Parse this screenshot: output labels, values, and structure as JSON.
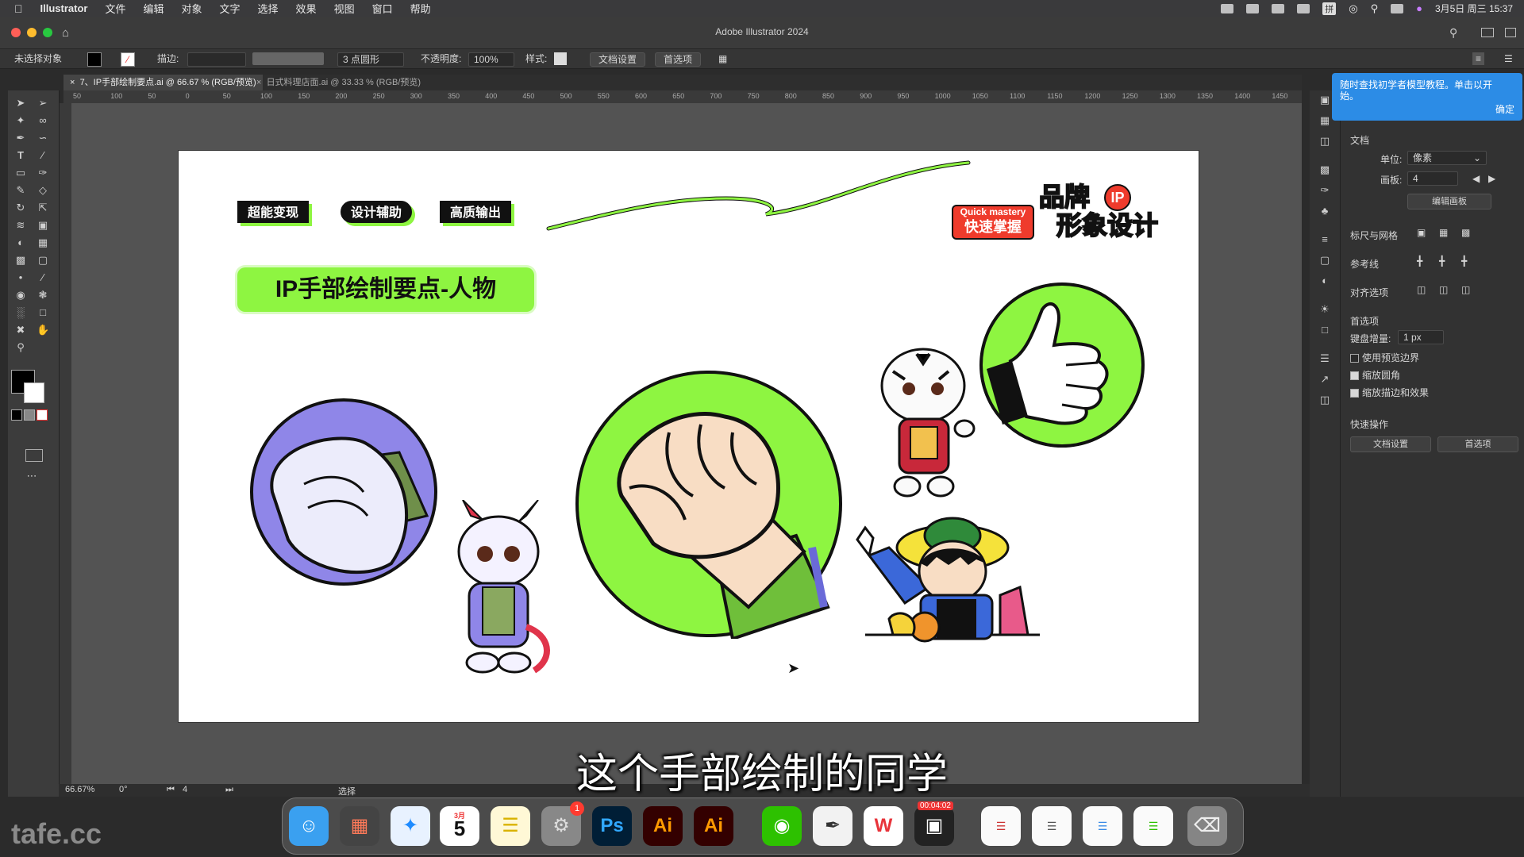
{
  "menubar": {
    "items": [
      "Illustrator",
      "文件",
      "编辑",
      "对象",
      "文字",
      "选择",
      "效果",
      "视图",
      "窗口",
      "帮助"
    ],
    "clock": "3月5日 周三 15:37",
    "ime": "拼"
  },
  "window": {
    "title": "Adobe Illustrator 2024"
  },
  "control": {
    "selection": "未选择对象",
    "stroke_label": "描边:",
    "brush": "3 点圆形",
    "opacity_label": "不透明度:",
    "opacity": "100%",
    "style_label": "样式:",
    "doc_settings": "文档设置",
    "prefs": "首选项"
  },
  "tabs": [
    {
      "label": "7、IP手部绘制要点.ai @ 66.67 % (RGB/预览)",
      "active": true
    },
    {
      "label": "日式料理店面.ai @ 33.33 % (RGB/预览)",
      "active": false
    }
  ],
  "ruler_ticks": [
    "50",
    "100",
    "50",
    "0",
    "50",
    "100",
    "150",
    "200",
    "250",
    "300",
    "350",
    "400",
    "450",
    "500",
    "550",
    "600",
    "650",
    "700",
    "750",
    "800",
    "850",
    "900",
    "950",
    "1000",
    "1050",
    "1100",
    "1150",
    "1200",
    "1250",
    "1300",
    "1350",
    "1400",
    "1450"
  ],
  "artboard": {
    "tags": [
      "超能变现",
      "设计辅助",
      "高质输出"
    ],
    "title": "IP手部绘制要点-人物",
    "badge_en": "Quick mastery",
    "badge_cn": "快速掌握",
    "brand_line1": "品牌",
    "brand_line2": "形象设计",
    "brand_ip": "IP"
  },
  "tooltip": {
    "text": "随时查找初学者模型教程。单击以开始。",
    "ok": "确定"
  },
  "props": {
    "section_doc": "文档",
    "unit_label": "单位:",
    "unit_value": "像素",
    "artboard_label": "画板:",
    "artboard_value": "4",
    "edit_artboard": "编辑画板",
    "rulers_grid": "标尺与网格",
    "guides": "参考线",
    "align_options": "对齐选项",
    "prefs_section": "首选项",
    "keyboard_inc_label": "键盘增量:",
    "keyboard_inc": "1 px",
    "use_preview_bounds": "使用预览边界",
    "scale_corners": "缩放圆角",
    "scale_strokes": "缩放描边和效果",
    "quick_actions": "快速操作",
    "doc_settings_btn": "文档设置",
    "prefs_btn": "首选项"
  },
  "status": {
    "zoom": "66.67%",
    "angle": "0°",
    "artboard": "4",
    "tool": "选择"
  },
  "dock": {
    "calendar_month": "3月",
    "calendar_day": "5",
    "badge": "1",
    "ps": "Ps",
    "ai": "Ai",
    "rec_time": "00:04:02"
  },
  "subtitle": "这个手部绘制的同学",
  "watermark": "tafe.cc",
  "colors": {
    "accent_green": "#8ef541",
    "ai_orange": "#ff9a00",
    "ps_blue": "#31a8ff",
    "purple": "#8f86e8"
  }
}
